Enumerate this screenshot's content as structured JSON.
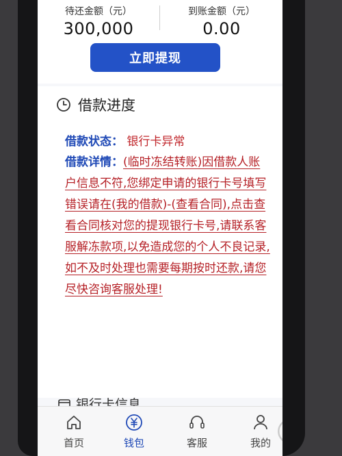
{
  "balance": {
    "pending_label": "待还金额（元）",
    "pending_value": "300,000",
    "arrived_label": "到账金额（元）",
    "arrived_value": "0.00"
  },
  "withdraw_button": "立即提现",
  "progress": {
    "title": "借款进度",
    "status_label": "借款状态：",
    "status_value": "银行卡异常",
    "details_label": "借款详情：",
    "details_text": "(临时冻结转账)因借款人账户信息不符,您绑定申请的银行卡号填写错误请在(我的借款)-(查看合同),点击查看合同核对您的提现银行卡号,请联系客服解冻款项,以免造成您的个人不良记录,如不及时处理也需要每期按时还款,请您尽快咨询客服处理!"
  },
  "next_section_title": "银行卡信息",
  "tabs": [
    {
      "label": "首页",
      "icon": "home-icon"
    },
    {
      "label": "钱包",
      "icon": "wallet-icon",
      "active": true
    },
    {
      "label": "客服",
      "icon": "headset-icon"
    },
    {
      "label": "我的",
      "icon": "person-icon"
    }
  ],
  "colors": {
    "accent": "#2352c7",
    "label_blue": "#1f49b6",
    "alert_red": "#b51f25"
  }
}
